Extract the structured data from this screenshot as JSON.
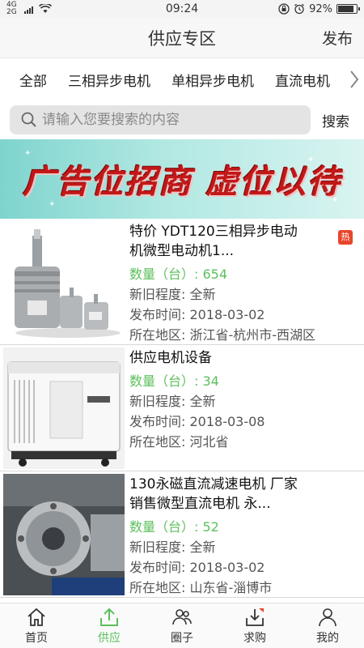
{
  "statusbar": {
    "network": "4G 2G",
    "time": "09:24",
    "battery": "92%",
    "battery_level": 0.92
  },
  "header": {
    "title": "供应专区",
    "publish": "发布"
  },
  "categories": [
    "全部",
    "三相异步电机",
    "单相异步电机",
    "直流电机"
  ],
  "search": {
    "placeholder": "请输入您要搜索的内容",
    "button": "搜索"
  },
  "banner": {
    "text": "广告位招商  虚位以待"
  },
  "items": [
    {
      "title": "特价 YDT120三相异步电动机微型电动机1...",
      "quantity": "数量（台）: 654",
      "condition": "新旧程度: 全新",
      "date": "发布时间: 2018-03-02",
      "region": "所在地区: 浙江省-杭州市-西湖区",
      "badge": "热"
    },
    {
      "title": "供应电机设备",
      "quantity": "数量（台）: 34",
      "condition": "新旧程度: 全新",
      "date": "发布时间: 2018-03-08",
      "region": "所在地区: 河北省"
    },
    {
      "title": "130永磁直流减速电机 厂家销售微型直流电机 永...",
      "quantity": "数量（台）: 52",
      "condition": "新旧程度: 全新",
      "date": "发布时间: 2018-03-02",
      "region": "所在地区: 山东省-淄博市"
    }
  ],
  "tabs": [
    {
      "label": "首页",
      "icon": "home-icon"
    },
    {
      "label": "供应",
      "icon": "upload-icon",
      "active": true
    },
    {
      "label": "圈子",
      "icon": "people-icon"
    },
    {
      "label": "求购",
      "icon": "download-icon"
    },
    {
      "label": "我的",
      "icon": "user-icon"
    }
  ],
  "colors": {
    "accent": "#5cbf5c",
    "banner_text": "#c21818"
  }
}
